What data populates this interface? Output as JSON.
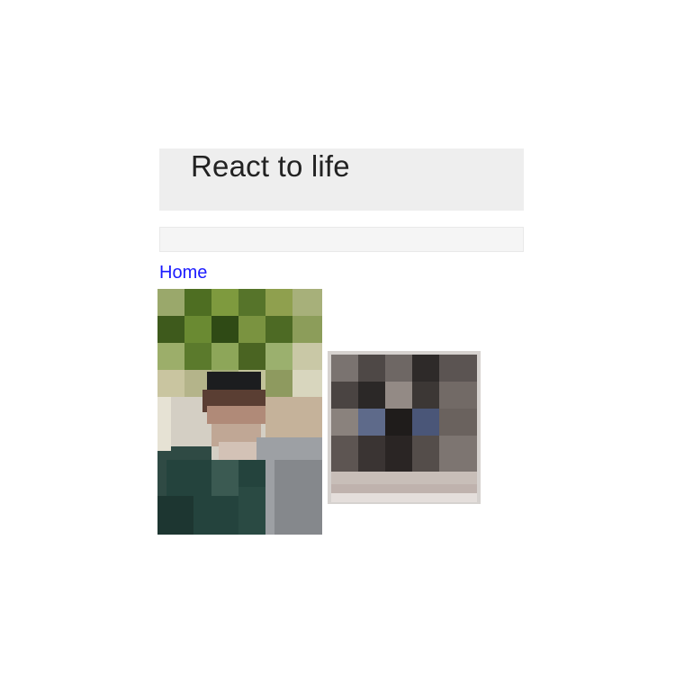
{
  "header": {
    "title": "React to life"
  },
  "nav": {
    "home_label": "Home"
  },
  "gallery": {
    "photos": [
      {
        "name": "portrait-photo",
        "subject": "person-under-tree"
      },
      {
        "name": "group-photo",
        "subject": "people-near-dark-backdrop"
      }
    ]
  },
  "colors": {
    "header_bg": "#eeeeee",
    "navbar_bg": "#f5f5f5",
    "link": "#1a1aff",
    "title_text": "#222222"
  }
}
